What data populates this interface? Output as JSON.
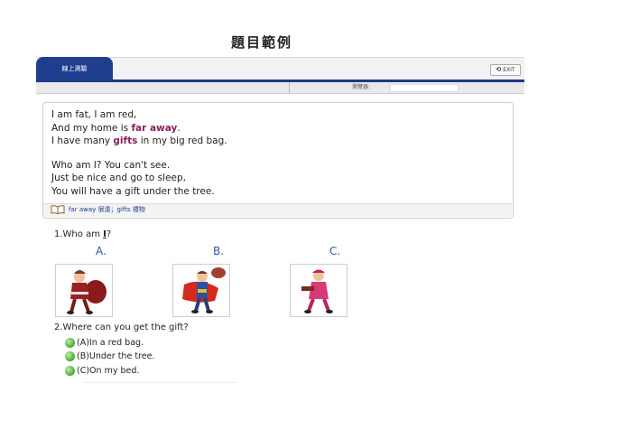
{
  "page": {
    "title": "題目範例"
  },
  "toolbar": {
    "tab_label": "線上測驗",
    "exit_label": "EXIT",
    "browser_label": "瀏覽器:"
  },
  "reading": {
    "line1_a": "I am fat, I am red,",
    "line2_a": "And my home is ",
    "line2_hl": "far away",
    "line2_b": ".",
    "line3_a": "I have many ",
    "line3_hl": "gifts",
    "line3_b": " in my big red bag.",
    "line4": "Who am I? You can't see.",
    "line5": "Just be nice and go to sleep,",
    "line6": "You will have a gift under the tree.",
    "vocab": "far away 很遠；gifts 禮物"
  },
  "question1": {
    "text_a": "1.Who am ",
    "text_u": "I",
    "text_b": "?",
    "options": [
      "A.",
      "B.",
      "C."
    ]
  },
  "question2": {
    "text": "2.Where can you get the gift?",
    "answers": [
      "(A)In a red bag.",
      "(B)Under the tree.",
      "(C)On my bed."
    ]
  },
  "colors": {
    "accent": "#1f3f8e",
    "highlight": "#8a1f5c",
    "option_letter": "#2a5aa8"
  }
}
